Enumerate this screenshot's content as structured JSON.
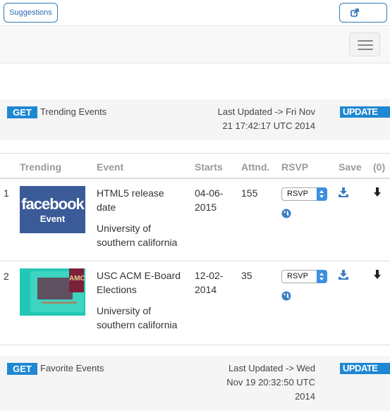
{
  "topbar": {
    "suggestions_label": "Suggestions",
    "external_icon": "external-link-icon"
  },
  "navbar": {
    "menu_icon": "hamburger-menu-icon"
  },
  "trending_header": {
    "get_label": "GET",
    "title": "Trending Events",
    "last_updated_line1": "Last Updated -> Fri Nov",
    "last_updated_line2": "21 17:42:17 UTC 2014",
    "update_label": "UPDATE"
  },
  "table": {
    "columns": [
      "Trending",
      "Event",
      "Starts",
      "Attnd.",
      "RSVP",
      "Save",
      "(0)"
    ],
    "rows": [
      {
        "index": "1",
        "thumb": {
          "brand": "facebook",
          "sub": "Event"
        },
        "event_line1": "HTML5 release",
        "event_line2": "date",
        "location_line1": "University of",
        "location_line2": "southern california",
        "starts_line1": "04-06-",
        "starts_line2": "2015",
        "attnd": "155",
        "rsvp": "RSVP"
      },
      {
        "index": "2",
        "thumb": {
          "logo": "AMC"
        },
        "event_line1": "USC ACM E-Board",
        "event_line2": "Elections",
        "location_line1": "University of",
        "location_line2": "southern california",
        "starts_line1": "12-02-",
        "starts_line2": "2014",
        "attnd": "35",
        "rsvp": "RSVP"
      }
    ]
  },
  "favorite_header": {
    "get_label": "GET",
    "title": "Favorite Events",
    "last_updated_line1": "Last Updated -> Wed",
    "last_updated_line2": "Nov 19 20:32:50 UTC",
    "last_updated_line3": "2014",
    "update_label": "UPDATE"
  },
  "colors": {
    "accent": "#1e88d3",
    "facebook": "#3a5a98",
    "acm_teal": "#23c7b5"
  }
}
